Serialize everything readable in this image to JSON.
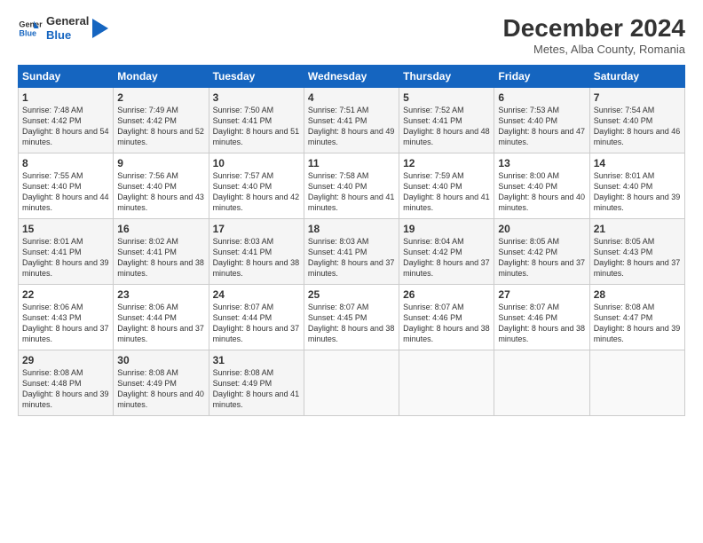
{
  "logo": {
    "line1": "General",
    "line2": "Blue"
  },
  "title": "December 2024",
  "subtitle": "Metes, Alba County, Romania",
  "headers": [
    "Sunday",
    "Monday",
    "Tuesday",
    "Wednesday",
    "Thursday",
    "Friday",
    "Saturday"
  ],
  "weeks": [
    [
      {
        "day": "1",
        "sunrise": "7:48 AM",
        "sunset": "4:42 PM",
        "daylight": "8 hours and 54 minutes."
      },
      {
        "day": "2",
        "sunrise": "7:49 AM",
        "sunset": "4:42 PM",
        "daylight": "8 hours and 52 minutes."
      },
      {
        "day": "3",
        "sunrise": "7:50 AM",
        "sunset": "4:41 PM",
        "daylight": "8 hours and 51 minutes."
      },
      {
        "day": "4",
        "sunrise": "7:51 AM",
        "sunset": "4:41 PM",
        "daylight": "8 hours and 49 minutes."
      },
      {
        "day": "5",
        "sunrise": "7:52 AM",
        "sunset": "4:41 PM",
        "daylight": "8 hours and 48 minutes."
      },
      {
        "day": "6",
        "sunrise": "7:53 AM",
        "sunset": "4:40 PM",
        "daylight": "8 hours and 47 minutes."
      },
      {
        "day": "7",
        "sunrise": "7:54 AM",
        "sunset": "4:40 PM",
        "daylight": "8 hours and 46 minutes."
      }
    ],
    [
      {
        "day": "8",
        "sunrise": "7:55 AM",
        "sunset": "4:40 PM",
        "daylight": "8 hours and 44 minutes."
      },
      {
        "day": "9",
        "sunrise": "7:56 AM",
        "sunset": "4:40 PM",
        "daylight": "8 hours and 43 minutes."
      },
      {
        "day": "10",
        "sunrise": "7:57 AM",
        "sunset": "4:40 PM",
        "daylight": "8 hours and 42 minutes."
      },
      {
        "day": "11",
        "sunrise": "7:58 AM",
        "sunset": "4:40 PM",
        "daylight": "8 hours and 41 minutes."
      },
      {
        "day": "12",
        "sunrise": "7:59 AM",
        "sunset": "4:40 PM",
        "daylight": "8 hours and 41 minutes."
      },
      {
        "day": "13",
        "sunrise": "8:00 AM",
        "sunset": "4:40 PM",
        "daylight": "8 hours and 40 minutes."
      },
      {
        "day": "14",
        "sunrise": "8:01 AM",
        "sunset": "4:40 PM",
        "daylight": "8 hours and 39 minutes."
      }
    ],
    [
      {
        "day": "15",
        "sunrise": "8:01 AM",
        "sunset": "4:41 PM",
        "daylight": "8 hours and 39 minutes."
      },
      {
        "day": "16",
        "sunrise": "8:02 AM",
        "sunset": "4:41 PM",
        "daylight": "8 hours and 38 minutes."
      },
      {
        "day": "17",
        "sunrise": "8:03 AM",
        "sunset": "4:41 PM",
        "daylight": "8 hours and 38 minutes."
      },
      {
        "day": "18",
        "sunrise": "8:03 AM",
        "sunset": "4:41 PM",
        "daylight": "8 hours and 37 minutes."
      },
      {
        "day": "19",
        "sunrise": "8:04 AM",
        "sunset": "4:42 PM",
        "daylight": "8 hours and 37 minutes."
      },
      {
        "day": "20",
        "sunrise": "8:05 AM",
        "sunset": "4:42 PM",
        "daylight": "8 hours and 37 minutes."
      },
      {
        "day": "21",
        "sunrise": "8:05 AM",
        "sunset": "4:43 PM",
        "daylight": "8 hours and 37 minutes."
      }
    ],
    [
      {
        "day": "22",
        "sunrise": "8:06 AM",
        "sunset": "4:43 PM",
        "daylight": "8 hours and 37 minutes."
      },
      {
        "day": "23",
        "sunrise": "8:06 AM",
        "sunset": "4:44 PM",
        "daylight": "8 hours and 37 minutes."
      },
      {
        "day": "24",
        "sunrise": "8:07 AM",
        "sunset": "4:44 PM",
        "daylight": "8 hours and 37 minutes."
      },
      {
        "day": "25",
        "sunrise": "8:07 AM",
        "sunset": "4:45 PM",
        "daylight": "8 hours and 38 minutes."
      },
      {
        "day": "26",
        "sunrise": "8:07 AM",
        "sunset": "4:46 PM",
        "daylight": "8 hours and 38 minutes."
      },
      {
        "day": "27",
        "sunrise": "8:07 AM",
        "sunset": "4:46 PM",
        "daylight": "8 hours and 38 minutes."
      },
      {
        "day": "28",
        "sunrise": "8:08 AM",
        "sunset": "4:47 PM",
        "daylight": "8 hours and 39 minutes."
      }
    ],
    [
      {
        "day": "29",
        "sunrise": "8:08 AM",
        "sunset": "4:48 PM",
        "daylight": "8 hours and 39 minutes."
      },
      {
        "day": "30",
        "sunrise": "8:08 AM",
        "sunset": "4:49 PM",
        "daylight": "8 hours and 40 minutes."
      },
      {
        "day": "31",
        "sunrise": "8:08 AM",
        "sunset": "4:49 PM",
        "daylight": "8 hours and 41 minutes."
      },
      null,
      null,
      null,
      null
    ]
  ],
  "labels": {
    "sunrise": "Sunrise:",
    "sunset": "Sunset:",
    "daylight": "Daylight:"
  }
}
